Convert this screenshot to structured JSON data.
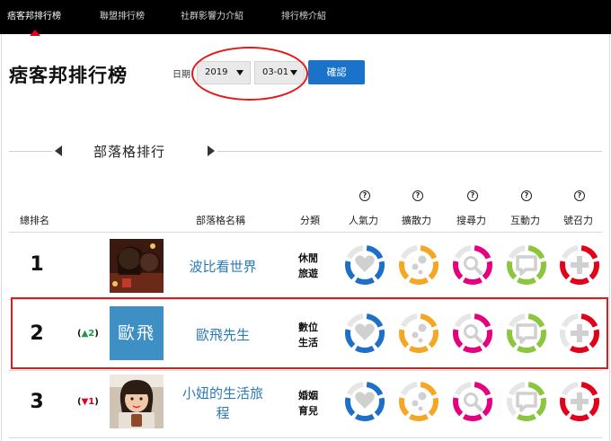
{
  "nav": {
    "items": [
      "痞客邦排行榜",
      "聯盟排行榜",
      "社群影響力介紹",
      "排行榜介紹"
    ],
    "active": 0
  },
  "page": {
    "title": "痞客邦排行榜",
    "date_label": "日期",
    "year": "2019",
    "month_day": "03-01",
    "confirm": "確認"
  },
  "section": {
    "title": "部落格排行"
  },
  "table": {
    "headers": {
      "rank": "總排名",
      "name": "部落格名稱",
      "category": "分類"
    },
    "metrics": [
      "人氣力",
      "擴散力",
      "搜尋力",
      "互動力",
      "號召力"
    ],
    "help_symbol": "?",
    "metric_icons": [
      "heart-icon",
      "dots-icon",
      "magnifier-icon",
      "chat-icon",
      "plus-icon"
    ],
    "metric_colors": [
      "#1e6fc8",
      "#f5a623",
      "#e5007f",
      "#8cc63f",
      "#e3001b"
    ],
    "rows": [
      {
        "rank": "1",
        "change": "",
        "change_dir": "",
        "name": "波比看世界",
        "category": [
          "休閒",
          "旅遊"
        ],
        "levels": [
          0.8,
          0.8,
          0.8,
          0.8,
          0.8
        ]
      },
      {
        "rank": "2",
        "change": "▲2",
        "change_dir": "up",
        "name": "歐飛先生",
        "avatar_text": "歐飛",
        "category": [
          "數位",
          "生活"
        ],
        "levels": [
          0.8,
          0.8,
          0.8,
          0.8,
          0.6
        ]
      },
      {
        "rank": "3",
        "change": "▼1",
        "change_dir": "down",
        "name": "小妞的生活旅程",
        "category": [
          "婚姻",
          "育兒"
        ],
        "levels": [
          0.8,
          0.8,
          0.8,
          0.6,
          0.8
        ]
      }
    ]
  }
}
